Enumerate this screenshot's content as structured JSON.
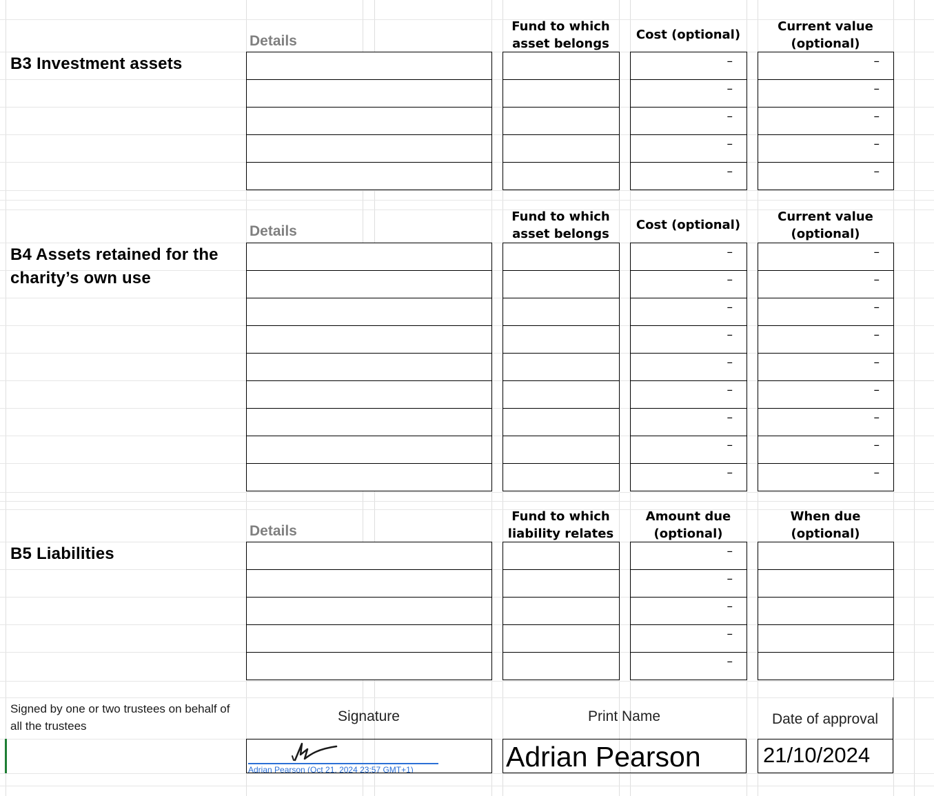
{
  "sections": {
    "b3": {
      "title": "B3 Investment assets",
      "details_label": "Details",
      "col_fund": "Fund to which asset belongs",
      "col_cost": "Cost (optional)",
      "col_value": "Current value (optional)",
      "rows": [
        {
          "details": "",
          "fund": "",
          "cost": "–",
          "value": "–"
        },
        {
          "details": "",
          "fund": "",
          "cost": "–",
          "value": "–"
        },
        {
          "details": "",
          "fund": "",
          "cost": "–",
          "value": "–"
        },
        {
          "details": "",
          "fund": "",
          "cost": "–",
          "value": "–"
        },
        {
          "details": "",
          "fund": "",
          "cost": "–",
          "value": "–"
        }
      ]
    },
    "b4": {
      "title": "B4 Assets retained for the charity’s own use",
      "details_label": "Details",
      "col_fund": "Fund to which asset belongs",
      "col_cost": "Cost (optional)",
      "col_value": "Current value (optional)",
      "rows": [
        {
          "details": "",
          "fund": "",
          "cost": "–",
          "value": "–"
        },
        {
          "details": "",
          "fund": "",
          "cost": "–",
          "value": "–"
        },
        {
          "details": "",
          "fund": "",
          "cost": "–",
          "value": "–"
        },
        {
          "details": "",
          "fund": "",
          "cost": "–",
          "value": "–"
        },
        {
          "details": "",
          "fund": "",
          "cost": "–",
          "value": "–"
        },
        {
          "details": "",
          "fund": "",
          "cost": "–",
          "value": "–"
        },
        {
          "details": "",
          "fund": "",
          "cost": "–",
          "value": "–"
        },
        {
          "details": "",
          "fund": "",
          "cost": "–",
          "value": "–"
        },
        {
          "details": "",
          "fund": "",
          "cost": "–",
          "value": "–"
        }
      ]
    },
    "b5": {
      "title": "B5 Liabilities",
      "details_label": "Details",
      "col_fund": "Fund to which liability relates",
      "col_cost": "Amount due (optional)",
      "col_value": "When due (optional)",
      "rows": [
        {
          "details": "",
          "fund": "",
          "cost": "–",
          "value": ""
        },
        {
          "details": "",
          "fund": "",
          "cost": "–",
          "value": ""
        },
        {
          "details": "",
          "fund": "",
          "cost": "–",
          "value": ""
        },
        {
          "details": "",
          "fund": "",
          "cost": "–",
          "value": ""
        },
        {
          "details": "",
          "fund": "",
          "cost": "–",
          "value": ""
        }
      ]
    }
  },
  "signoff": {
    "note": "Signed by one or two trustees on behalf of all the trustees",
    "signature_label": "Signature",
    "print_name_label": "Print Name",
    "date_label": "Date of approval",
    "signature_caption": "Adrian Pearson (Oct 21, 2024 23:57 GMT+1)",
    "print_name_value": "Adrian Pearson",
    "date_value": "21/10/2024"
  },
  "colors": {
    "grid": "#dedede",
    "details_label": "#7f7f7f",
    "signature_ink": "#1a1a1a",
    "signature_line": "#2b6fd6",
    "signature_caption": "#2b6fd6",
    "active_row_marker": "#1e7e34"
  },
  "icons": [
    "handwritten-signature-icon"
  ]
}
